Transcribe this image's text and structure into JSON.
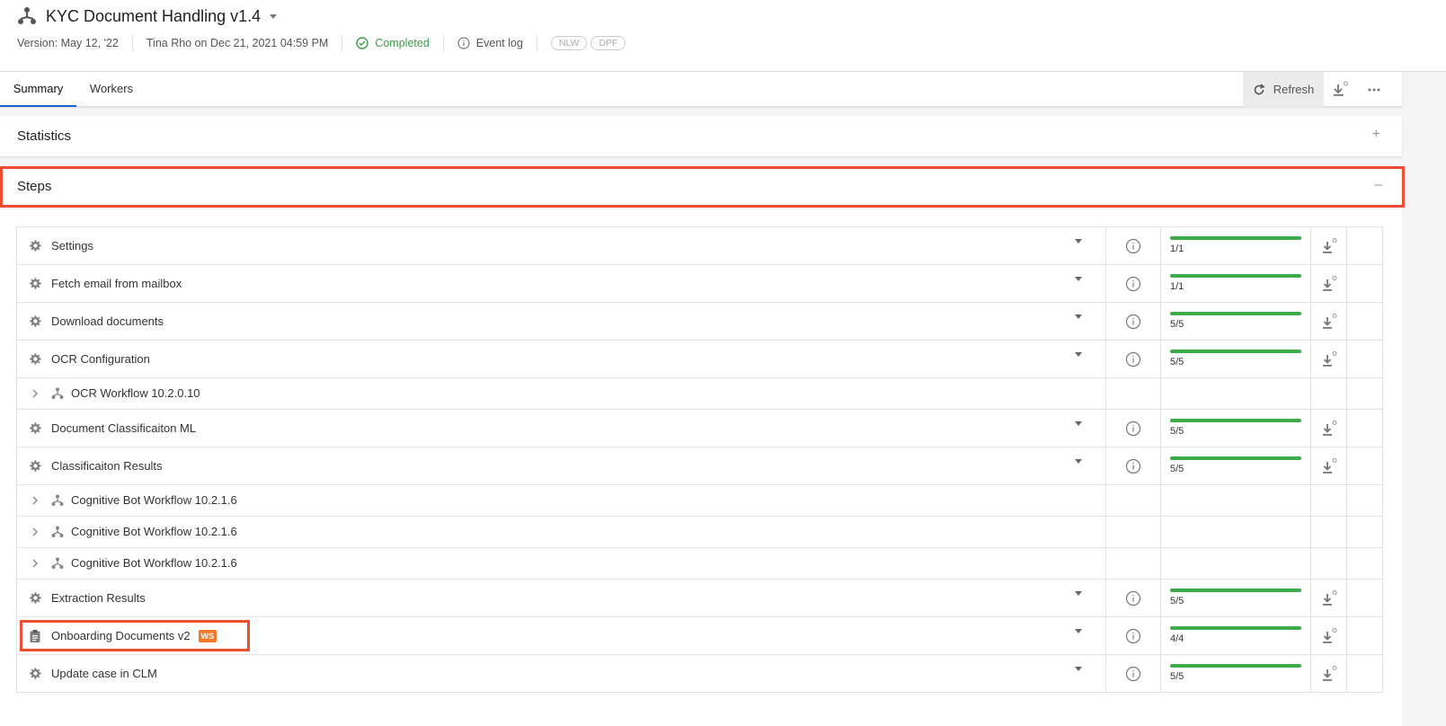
{
  "header": {
    "title": "KYC Document Handling v1.4",
    "version": "Version: May 12, '22",
    "author": "Tina Rho on Dec 21, 2021 04:59 PM",
    "status": "Completed",
    "event_log": "Event log",
    "tags": [
      "NLW",
      "DPF"
    ]
  },
  "tabs": [
    {
      "label": "Summary"
    },
    {
      "label": "Workers"
    }
  ],
  "toolbar": {
    "refresh_label": "Refresh"
  },
  "sections": {
    "statistics": "Statistics",
    "steps": "Steps"
  },
  "steps": [
    {
      "kind": "step",
      "icon": "gear-icon",
      "label": "Settings",
      "progress": "1/1",
      "fill": 1.0
    },
    {
      "kind": "step",
      "icon": "gear-icon",
      "label": "Fetch email from mailbox",
      "progress": "1/1",
      "fill": 1.0
    },
    {
      "kind": "step",
      "icon": "gear-icon",
      "label": "Download documents",
      "progress": "5/5",
      "fill": 1.0
    },
    {
      "kind": "step",
      "icon": "gear-icon",
      "label": "OCR Configuration",
      "progress": "5/5",
      "fill": 1.0
    },
    {
      "kind": "workflow",
      "icon": "workflow-icon",
      "label": "OCR Workflow 10.2.0.10"
    },
    {
      "kind": "step",
      "icon": "gear-icon",
      "label": "Document Classificaiton ML",
      "progress": "5/5",
      "fill": 1.0
    },
    {
      "kind": "step",
      "icon": "gear-icon",
      "label": "Classificaiton Results",
      "progress": "5/5",
      "fill": 1.0
    },
    {
      "kind": "workflow",
      "icon": "workflow-icon",
      "label": "Cognitive Bot Workflow 10.2.1.6"
    },
    {
      "kind": "workflow",
      "icon": "workflow-icon",
      "label": "Cognitive Bot Workflow 10.2.1.6"
    },
    {
      "kind": "workflow",
      "icon": "workflow-icon",
      "label": "Cognitive Bot Workflow 10.2.1.6"
    },
    {
      "kind": "step",
      "icon": "gear-icon",
      "label": "Extraction Results",
      "progress": "5/5",
      "fill": 1.0
    },
    {
      "kind": "step",
      "icon": "clipboard-icon",
      "label": "Onboarding Documents v2",
      "badge": "WS",
      "progress": "4/4",
      "fill": 1.0
    },
    {
      "kind": "step",
      "icon": "gear-icon",
      "label": "Update case in CLM",
      "progress": "5/5",
      "fill": 1.0
    }
  ],
  "colors": {
    "accent": "#1a5fcf",
    "success": "#3eab4a",
    "highlight": "#f04e30",
    "badge": "#f47a2a"
  }
}
